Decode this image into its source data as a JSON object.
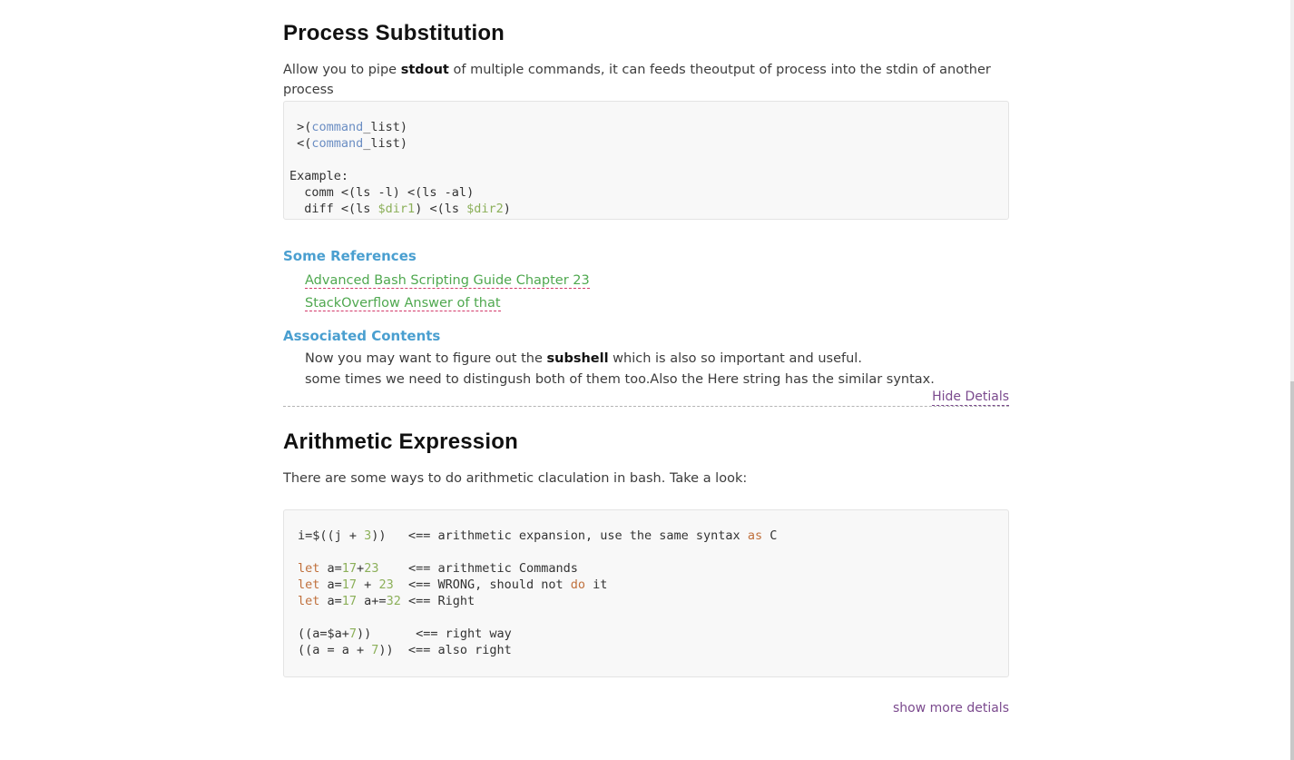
{
  "section1": {
    "title": "Process Substitution",
    "intro_pre": "Allow you to pipe ",
    "intro_bold": "stdout",
    "intro_post": " of multiple commands, it can feeds theoutput of process into the stdin of another process",
    "code": {
      "l1_a": " >(",
      "l1_kw": "command",
      "l1_b": "_list)",
      "l2_a": " <(",
      "l2_kw": "command",
      "l2_b": "_list)",
      "l4": "Example:",
      "l5": "  comm <(ls -l) <(ls -al)",
      "l6_a": "  diff <(ls ",
      "l6_v1": "$dir1",
      "l6_b": ") <(ls ",
      "l6_v2": "$dir2",
      "l6_c": ")"
    },
    "references_title": "Some References",
    "references": [
      "Advanced Bash Scripting Guide Chapter 23",
      "StackOverflow Answer of that"
    ],
    "associated_title": "Associated Contents",
    "assoc_line1_pre": "Now you may want to figure out the ",
    "assoc_line1_bold": "subshell",
    "assoc_line1_post": " which is also so important and useful.",
    "assoc_line2": "some times we need to distingush both of them too.Also the Here string has the similar syntax.",
    "hide_label": "Hide Detials"
  },
  "section2": {
    "title": "Arithmetic Expression",
    "intro": "There are some ways to do arithmetic claculation in bash. Take a look:",
    "code": {
      "l1_a": "i=$((j + ",
      "l1_n": "3",
      "l1_b": "))   <== arithmetic expansion, use the same syntax ",
      "l1_kw": "as",
      "l1_c": " C",
      "l3_kw": "let",
      "l3_a": " a=",
      "l3_n1": "17",
      "l3_b": "+",
      "l3_n2": "23",
      "l3_c": "    <== arithmetic Commands",
      "l4_kw": "let",
      "l4_a": " a=",
      "l4_n1": "17",
      "l4_b": " + ",
      "l4_n2": "23",
      "l4_c": "  <== WRONG, should not ",
      "l4_kw2": "do",
      "l4_d": " it",
      "l5_kw": "let",
      "l5_a": " a=",
      "l5_n1": "17",
      "l5_b": " a+=",
      "l5_n2": "32",
      "l5_c": " <== Right",
      "l7_a": "((a=$a+",
      "l7_n": "7",
      "l7_b": "))      <== right way",
      "l8_a": "((a = a + ",
      "l8_n": "7",
      "l8_b": "))  <== also right"
    },
    "more_label": "show more detials"
  }
}
